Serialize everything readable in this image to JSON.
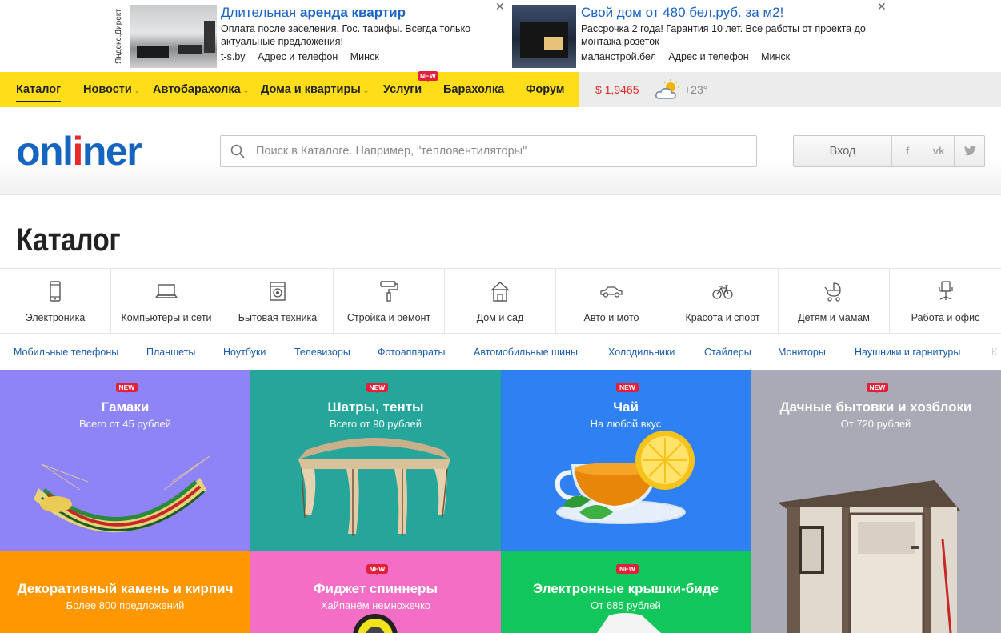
{
  "ads": {
    "label": "Яндекс.Директ",
    "items": [
      {
        "title_plain": "Длительная ",
        "title_bold": "аренда квартир",
        "desc": "Оплата после заселения. Гос. тарифы. Всегда только актуальные предложения!",
        "domain": "t-s.by",
        "contact": "Адрес и телефон",
        "city": "Минск",
        "close": "✕"
      },
      {
        "title_plain": "Свой дом от 480 бел.руб. за м2!",
        "title_bold": "",
        "desc": "Рассрочка 2 года! Гарантия 10 лет. Все работы от проекта до монтажа розеток",
        "domain": "маланстрой.бел",
        "contact": "Адрес и телефон",
        "city": "Минск",
        "close": "✕"
      }
    ]
  },
  "topnav": {
    "items": [
      {
        "label": "Каталог"
      },
      {
        "label": "Новости"
      },
      {
        "label": "Автобарахолка"
      },
      {
        "label": "Дома и квартиры"
      },
      {
        "label": "Услуги",
        "badge": "NEW"
      },
      {
        "label": "Барахолка"
      },
      {
        "label": "Форум"
      }
    ],
    "rate": "$ 1,9465",
    "temperature": "+23°",
    "weather_icon": "partly-cloudy-icon"
  },
  "header": {
    "logo_pre": "onl",
    "logo_i": "i",
    "logo_post": "ner",
    "search_placeholder": "Поиск в Каталоге. Например, \"тепловентиляторы\"",
    "login": "Вход",
    "social": [
      "f",
      "vk",
      "t"
    ]
  },
  "page_title": "Каталог",
  "categories": [
    {
      "label": "Электроника",
      "icon": "phone-icon"
    },
    {
      "label": "Компьютеры и сети",
      "icon": "laptop-icon"
    },
    {
      "label": "Бытовая техника",
      "icon": "washer-icon"
    },
    {
      "label": "Стройка и ремонт",
      "icon": "paint-roller-icon"
    },
    {
      "label": "Дом и сад",
      "icon": "house-icon"
    },
    {
      "label": "Авто и мото",
      "icon": "car-icon"
    },
    {
      "label": "Красота и спорт",
      "icon": "bicycle-icon"
    },
    {
      "label": "Детям и мамам",
      "icon": "stroller-icon"
    },
    {
      "label": "Работа и офис",
      "icon": "office-chair-icon"
    }
  ],
  "sublinks": [
    "Мобильные телефоны",
    "Планшеты",
    "Ноутбуки",
    "Телевизоры",
    "Фотоаппараты",
    "Автомобильные шины",
    "Холодильники",
    "Стайлеры",
    "Мониторы",
    "Наушники и гарнитуры",
    "К"
  ],
  "tiles": [
    {
      "title": "Гамаки",
      "sub": "Всего от 45 рублей",
      "badge": "NEW",
      "color": "#8f83f8"
    },
    {
      "title": "Шатры, тенты",
      "sub": "Всего от 90 рублей",
      "badge": "NEW",
      "color": "#26a69a"
    },
    {
      "title": "Чай",
      "sub": "На любой вкус",
      "badge": "NEW",
      "color": "#2f80f2"
    },
    {
      "title": "Дачные бытовки и хозблоки",
      "sub": "От 720 рублей",
      "badge": "NEW",
      "color": "#a9aab5"
    },
    {
      "title": "Декоративный камень и кирпич",
      "sub": "Более 800 предложений",
      "badge": "",
      "color": "#ff9800"
    },
    {
      "title": "Фиджет спиннеры",
      "sub": "Хайпанём немножечко",
      "badge": "NEW",
      "color": "#f36ec4"
    },
    {
      "title": "Электронные крышки-биде",
      "sub": "От 685 рублей",
      "badge": "NEW",
      "color": "#11c65a"
    }
  ]
}
